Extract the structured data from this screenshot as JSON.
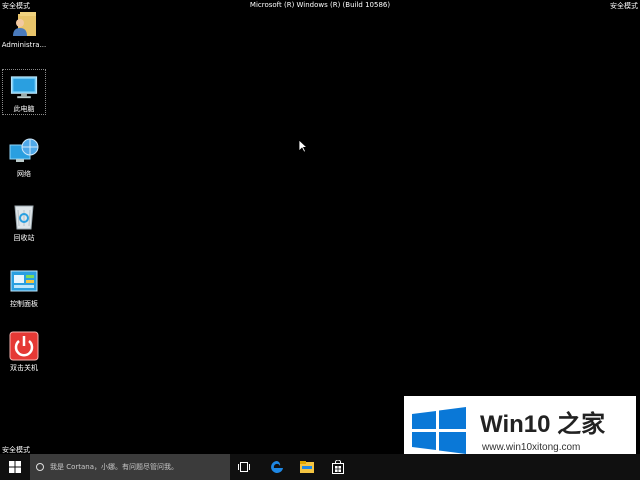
{
  "safe_mode_label": "安全模式",
  "title": "Microsoft (R) Windows (R) (Build 10586)",
  "desktop_icons": [
    {
      "label": "Administra...",
      "icon": "user-folder-icon"
    },
    {
      "label": "此电脑",
      "icon": "computer-icon",
      "selected": true
    },
    {
      "label": "网络",
      "icon": "network-icon"
    },
    {
      "label": "回收站",
      "icon": "recycle-bin-icon"
    },
    {
      "label": "控制面板",
      "icon": "control-panel-icon"
    },
    {
      "label": "双击关机",
      "icon": "shutdown-icon"
    }
  ],
  "taskbar": {
    "search_placeholder": "我是 Cortana，小娜。有问题尽管问我。",
    "icons": [
      "windows-logo-icon",
      "cortana-circle-icon",
      "task-view-icon",
      "edge-icon",
      "file-explorer-icon",
      "store-icon"
    ]
  },
  "watermark": {
    "brand": "Win10 之家",
    "url": "www.win10xitong.com"
  },
  "colors": {
    "desktop_bg": "#000000",
    "taskbar_bg": "#101010",
    "search_bg": "#3b3b3b",
    "win_blue": "#0a78d7",
    "shutdown_red": "#e53935"
  }
}
